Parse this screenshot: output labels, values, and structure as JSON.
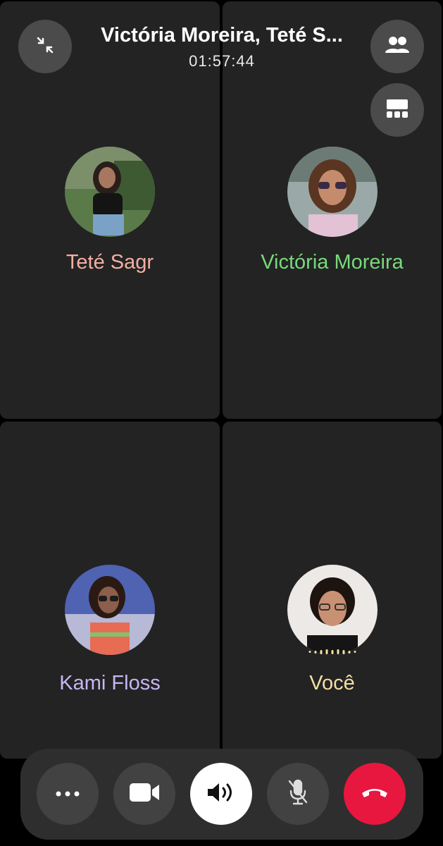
{
  "header": {
    "title": "Victória Moreira, Teté S...",
    "timer": "01:57:44"
  },
  "participants": [
    {
      "name": "Teté Sagr",
      "color": "#f2b0a2"
    },
    {
      "name": "Victória Moreira",
      "color": "#78d97c"
    },
    {
      "name": "Kami Floss",
      "color": "#c7b6f2"
    },
    {
      "name": "Você",
      "color": "#f3dea3"
    }
  ],
  "buttons": {
    "minimize": "minimize-icon",
    "people": "people-icon",
    "layout": "grid-layout-icon",
    "more": "more-icon",
    "video": "video-camera-icon",
    "speaker": "speaker-icon",
    "mute": "microphone-muted-icon",
    "end": "end-call-icon"
  },
  "accent": {
    "end_call": "#e8173f"
  }
}
